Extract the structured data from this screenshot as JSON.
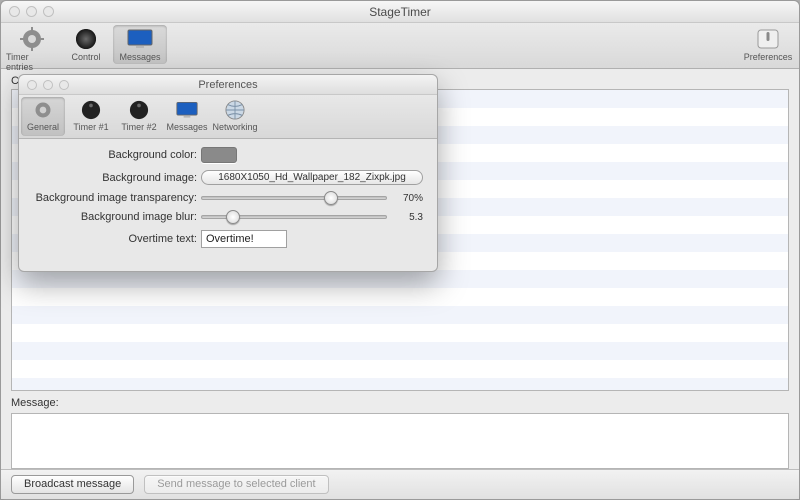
{
  "app": {
    "title": "StageTimer"
  },
  "toolbar": {
    "items": [
      {
        "label": "Timer entries"
      },
      {
        "label": "Control"
      },
      {
        "label": "Messages"
      }
    ],
    "right": {
      "label": "Preferences"
    }
  },
  "clients": {
    "label": "Connected clients:"
  },
  "message": {
    "label": "Message:"
  },
  "buttons": {
    "broadcast": "Broadcast message",
    "sendSelected": "Send message to selected client"
  },
  "pref": {
    "title": "Preferences",
    "tabs": {
      "general": "General",
      "timer1": "Timer #1",
      "timer2": "Timer #2",
      "messages": "Messages",
      "networking": "Networking"
    },
    "labels": {
      "bgColor": "Background color:",
      "bgImage": "Background image:",
      "bgTransparency": "Background image transparency:",
      "bgBlur": "Background image blur:",
      "overtime": "Overtime text:"
    },
    "values": {
      "bgColor": "#8a8a8a",
      "bgImageFile": "1680X1050_Hd_Wallpaper_182_Zixpk.jpg",
      "transparencyDisplay": "70%",
      "transparencyPct": 70,
      "blurDisplay": "5.3",
      "blurPct": 17,
      "overtime": "Overtime!"
    }
  }
}
